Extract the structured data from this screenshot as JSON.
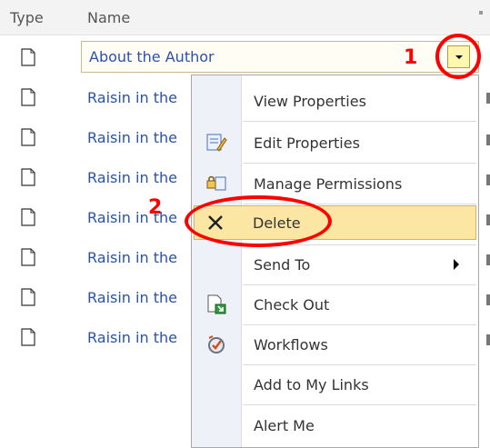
{
  "header": {
    "type_label": "Type",
    "name_label": "Name"
  },
  "selected_row": {
    "label": "About the Author"
  },
  "rows": [
    {
      "label": "Raisin in the"
    },
    {
      "label": "Raisin in the"
    },
    {
      "label": "Raisin in the"
    },
    {
      "label": "Raisin in the"
    },
    {
      "label": "Raisin in the"
    },
    {
      "label": "Raisin in the"
    },
    {
      "label": "Raisin in the"
    }
  ],
  "menu": {
    "items": [
      {
        "label": "View Properties",
        "icon": "none"
      },
      {
        "label": "Edit Properties",
        "icon": "edit-properties-icon"
      },
      {
        "label": "Manage Permissions",
        "icon": "manage-permissions-icon"
      },
      {
        "label": "Delete",
        "icon": "delete-icon",
        "highlighted": true
      },
      {
        "label": "Send To",
        "icon": "none",
        "submenu": true
      },
      {
        "label": "Check Out",
        "icon": "check-out-icon"
      },
      {
        "label": "Workflows",
        "icon": "workflows-icon"
      },
      {
        "label": "Add to My Links",
        "icon": "none"
      },
      {
        "label": "Alert Me",
        "icon": "none"
      }
    ]
  },
  "annotations": {
    "step1": "1",
    "step2": "2"
  },
  "colors": {
    "link": "#2a52a6",
    "annotation": "#ff0000",
    "highlight": "#fce6a4"
  }
}
